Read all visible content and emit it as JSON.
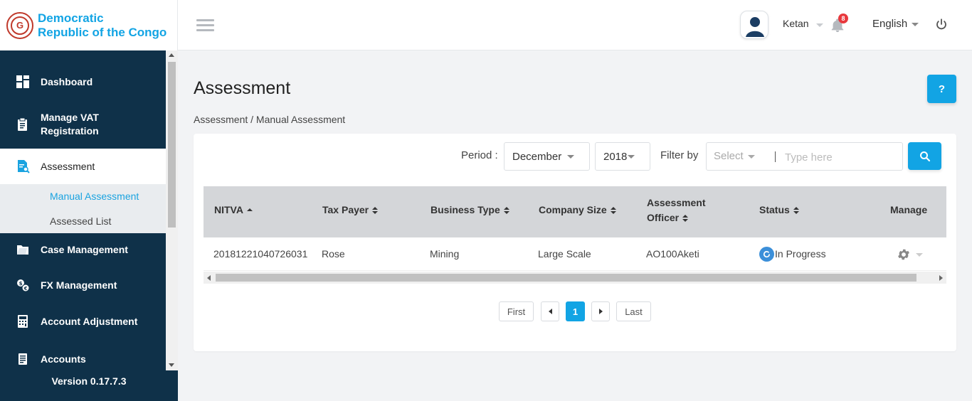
{
  "brand": {
    "line1": "Democratic",
    "line2": "Republic of the Congo"
  },
  "header": {
    "user_name": "Ketan",
    "notification_count": "8",
    "language": "English"
  },
  "sidebar": {
    "items": [
      {
        "label": "Dashboard"
      },
      {
        "label": "Manage VAT Registration"
      },
      {
        "label": "Assessment"
      },
      {
        "label": "Case Management"
      },
      {
        "label": "FX Management"
      },
      {
        "label": "Account Adjustment"
      },
      {
        "label": "Accounts"
      }
    ],
    "sub_items": [
      {
        "label": "Manual Assessment"
      },
      {
        "label": "Assessed List"
      }
    ],
    "version": "Version 0.17.7.3"
  },
  "page": {
    "title": "Assessment",
    "help_label": "?",
    "breadcrumb": "Assessment / Manual Assessment"
  },
  "filters": {
    "period_label": "Period :",
    "month": "December",
    "year": "2018",
    "filter_by_label": "Filter by",
    "filter_select": "Select",
    "search_placeholder": "Type here"
  },
  "table": {
    "columns": [
      "NITVA",
      "Tax Payer",
      "Business Type",
      "Company Size",
      "Assessment Officer",
      "Status",
      "Manage"
    ],
    "officer_line1": "Assessment",
    "officer_line2": "Officer",
    "rows": [
      {
        "nitva": "20181221040726031",
        "tax_payer": "Rose",
        "business_type": "Mining",
        "company_size": "Large Scale",
        "officer": "AO100Aketi",
        "status": "In Progress"
      }
    ]
  },
  "pagination": {
    "first": "First",
    "current": "1",
    "last": "Last"
  },
  "colors": {
    "accent": "#12a4e4",
    "sidebar_bg": "#0f3149",
    "badge": "#e8383d"
  }
}
